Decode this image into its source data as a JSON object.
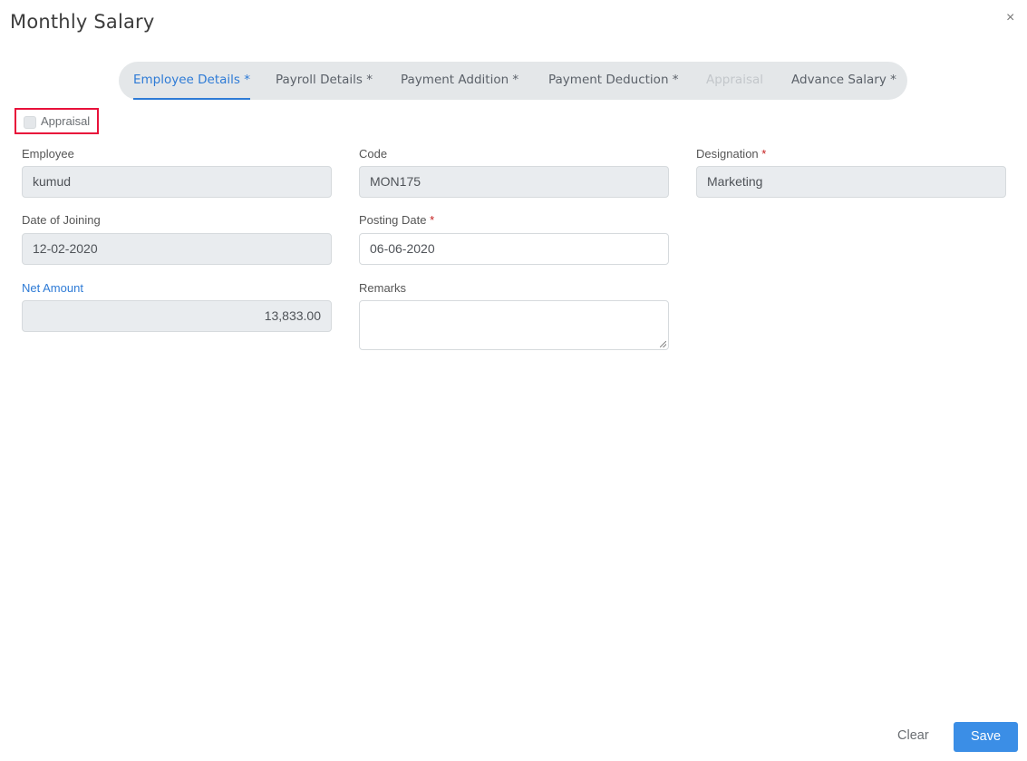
{
  "dialog": {
    "title": "Monthly Salary",
    "close_icon": "×"
  },
  "tabs": [
    {
      "label": "Employee Details *",
      "state": "active"
    },
    {
      "label": "Payroll Details *",
      "state": "normal"
    },
    {
      "label": "Payment Addition *",
      "state": "normal"
    },
    {
      "label": "Payment Deduction *",
      "state": "normal"
    },
    {
      "label": "Appraisal",
      "state": "disabled"
    },
    {
      "label": "Advance Salary *",
      "state": "normal"
    }
  ],
  "appraisal_checkbox": {
    "label": "Appraisal",
    "checked": false
  },
  "form": {
    "employee": {
      "label": "Employee",
      "value": "kumud"
    },
    "code": {
      "label": "Code",
      "value": "MON175"
    },
    "designation": {
      "label": "Designation",
      "required": "*",
      "value": "Marketing"
    },
    "date_of_joining": {
      "label": "Date of Joining",
      "value": "12-02-2020"
    },
    "posting_date": {
      "label": "Posting Date",
      "required": "*",
      "value": "06-06-2020"
    },
    "net_amount": {
      "label": "Net Amount",
      "value": "13,833.00"
    },
    "remarks": {
      "label": "Remarks",
      "value": ""
    }
  },
  "footer": {
    "clear_label": "Clear",
    "save_label": "Save"
  },
  "colors": {
    "accent": "#2e7bd6",
    "save_button": "#3b8ee6",
    "highlight_border": "#e8113a",
    "required": "#c41d1d"
  }
}
